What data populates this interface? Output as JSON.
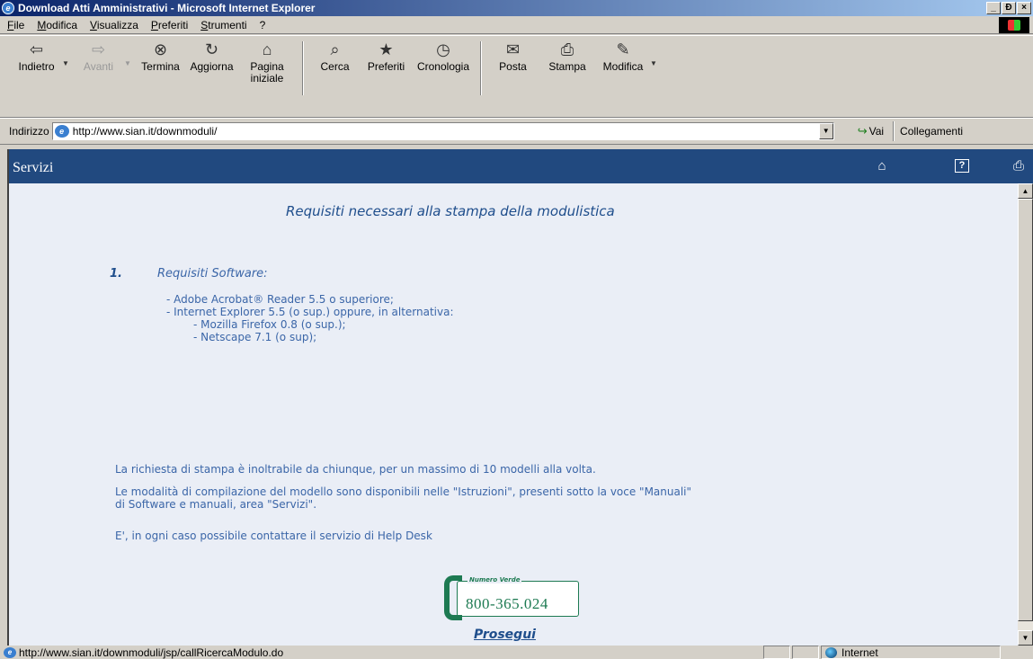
{
  "window": {
    "title": "Download Atti Amministrativi - Microsoft Internet Explorer",
    "controls": [
      "_",
      "Ɖ",
      "×"
    ]
  },
  "menu": [
    "File",
    "Modifica",
    "Visualizza",
    "Preferiti",
    "Strumenti",
    "?"
  ],
  "toolbar": {
    "buttons": [
      {
        "label": "Indietro",
        "icon": "back-arrow-icon",
        "glyph": "⇦",
        "enabled": true
      },
      {
        "label": "Avanti",
        "icon": "forward-arrow-icon",
        "glyph": "⇨",
        "enabled": false
      },
      {
        "label": "Termina",
        "icon": "stop-icon",
        "glyph": "⊗",
        "enabled": true
      },
      {
        "label": "Aggiorna",
        "icon": "refresh-icon",
        "glyph": "↻",
        "enabled": true
      },
      {
        "label": "Pagina iniziale",
        "icon": "home-icon",
        "glyph": "⌂",
        "enabled": true
      },
      {
        "label": "Cerca",
        "icon": "search-icon",
        "glyph": "⌕",
        "enabled": true
      },
      {
        "label": "Preferiti",
        "icon": "favorites-icon",
        "glyph": "★",
        "enabled": true
      },
      {
        "label": "Cronologia",
        "icon": "history-icon",
        "glyph": "◷",
        "enabled": true
      },
      {
        "label": "Posta",
        "icon": "mail-icon",
        "glyph": "✉",
        "enabled": true
      },
      {
        "label": "Stampa",
        "icon": "print-icon",
        "glyph": "⎙",
        "enabled": true
      },
      {
        "label": "Modifica",
        "icon": "edit-icon",
        "glyph": "✎",
        "enabled": true
      }
    ]
  },
  "address": {
    "label": "Indirizzo",
    "url": "http://www.sian.it/downmoduli/",
    "go_label": "Vai",
    "links_label": "Collegamenti"
  },
  "site": {
    "brand": "Servizi",
    "heading": "Requisiti necessari alla stampa della modulistica",
    "section_number": "1.",
    "section_title": "Requisiti Software:",
    "requirements": [
      "- Adobe Acrobat® Reader 5.5 o superiore;",
      "- Internet Explorer 5.5 (o sup.) oppure, in alternativa:"
    ],
    "alternatives": [
      "- Mozilla Firefox 0.8 (o sup.);",
      "- Netscape 7.1 (o sup);"
    ],
    "para1": "La richiesta di stampa è inoltrabile da chiunque, per un massimo di 10 modelli alla volta.",
    "para2_line1": "Le modalità di compilazione del modello sono disponibili nelle \"Istruzioni\", presenti sotto la voce \"Manuali\"",
    "para2_line2": "di Software e manuali, area \"Servizi\".",
    "para3": "E', in ogni caso possibile contattare il servizio di Help Desk",
    "toll_free_label": "Numero Verde",
    "toll_free_number": "800-365.024",
    "proceed_link": "Prosegui"
  },
  "status": {
    "text": "http://www.sian.it/downmoduli/jsp/callRicercaModulo.do",
    "zone": "Internet"
  }
}
